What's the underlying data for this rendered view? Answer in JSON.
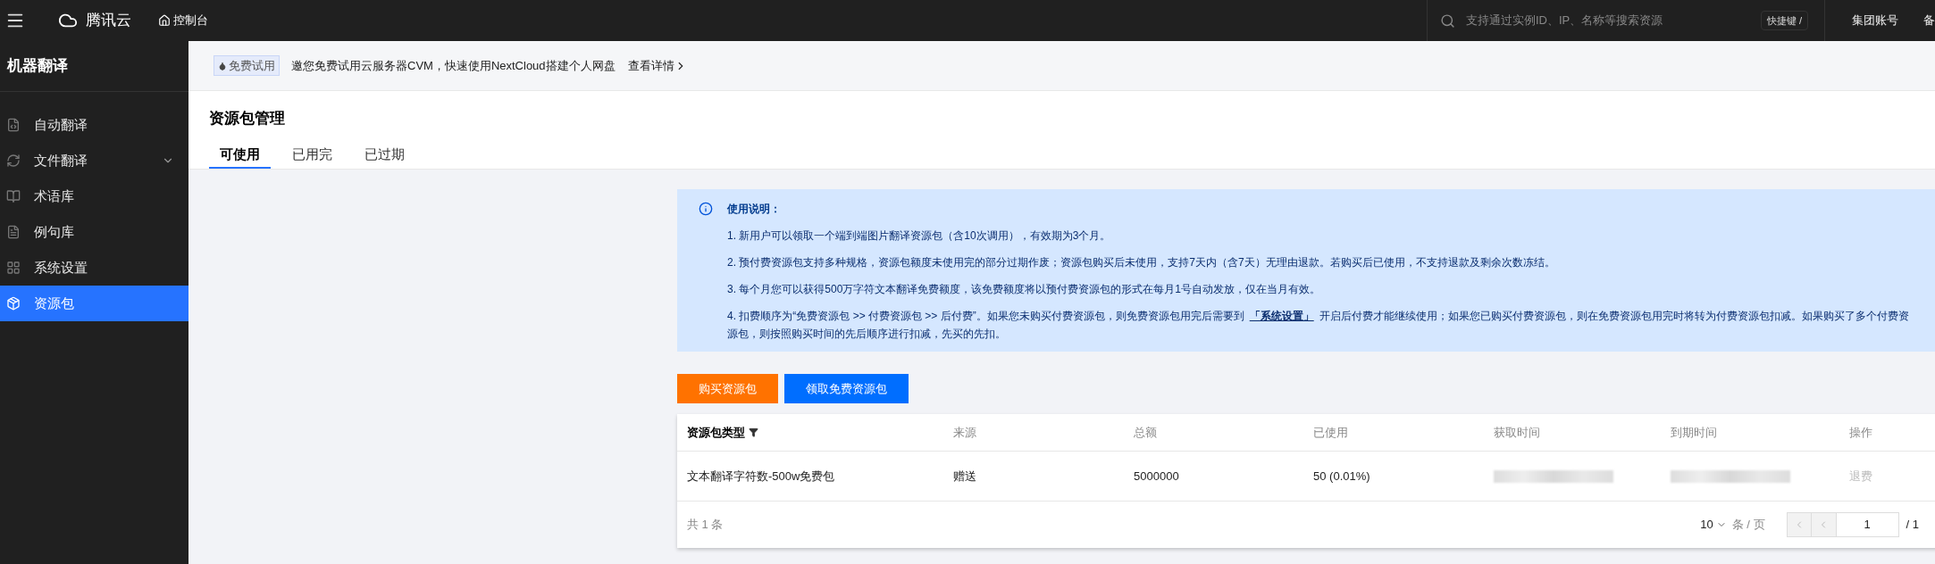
{
  "topbar": {
    "brand": "腾讯云",
    "console": "控制台",
    "search": {
      "placeholder": "支持通过实例ID、IP、名称等搜索资源"
    },
    "shortcut": "快捷键 /",
    "links": [
      "集团账号",
      "备"
    ]
  },
  "sidebar": {
    "title": "机器翻译",
    "items": [
      {
        "label": "自动翻译",
        "selected": false,
        "expandable": false
      },
      {
        "label": "文件翻译",
        "selected": false,
        "expandable": true
      },
      {
        "label": "术语库",
        "selected": false,
        "expandable": false
      },
      {
        "label": "例句库",
        "selected": false,
        "expandable": false
      },
      {
        "label": "系统设置",
        "selected": false,
        "expandable": false
      },
      {
        "label": "资源包",
        "selected": true,
        "expandable": false
      }
    ]
  },
  "banner": {
    "tag": "免费试用",
    "text": "邀您免费试用云服务器CVM，快速使用NextCloud搭建个人网盘",
    "link": "查看详情"
  },
  "page": {
    "title": "资源包管理",
    "tabs": [
      {
        "label": "可使用",
        "selected": true
      },
      {
        "label": "已用完",
        "selected": false
      },
      {
        "label": "已过期",
        "selected": false
      }
    ]
  },
  "notice": {
    "title": "使用说明：",
    "items": [
      {
        "text": "1. 新用户可以领取一个端到端图片翻译资源包（含10次调用），有效期为3个月。"
      },
      {
        "text": "2. 预付费资源包支持多种规格，资源包额度未使用完的部分过期作废；资源包购买后未使用，支持7天内（含7天）无理由退款。若购买后已使用，不支持退款及剩余次数冻结。"
      },
      {
        "text": "3. 每个月您可以获得500万字符文本翻译免费额度，该免费额度将以预付费资源包的形式在每月1号自动发放，仅在当月有效。"
      },
      {
        "text": "4. 扣费顺序为“免费资源包 >> 付费资源包 >> 后付费”。如果您未购买付费资源包，则免费资源包用完后需要到",
        "link": "「系统设置」",
        "after": "开启后付费才能继续使用；如果您已购买付费资源包，则在免费资源包用完时将转为付费资源包扣减。如果购买了多个付费资源包，则按照购买时间的先后顺序进行扣减，先买的先扣。"
      }
    ]
  },
  "buttons": [
    {
      "label": "购买资源包",
      "kind": "warning"
    },
    {
      "label": "领取免费资源包",
      "kind": "primary"
    }
  ],
  "table": {
    "columns": [
      {
        "label": "资源包类型",
        "filter": true
      },
      {
        "label": "来源",
        "filter": false
      },
      {
        "label": "总额",
        "filter": false
      },
      {
        "label": "已使用",
        "filter": false
      },
      {
        "label": "获取时间",
        "filter": false
      },
      {
        "label": "到期时间",
        "filter": false
      },
      {
        "label": "操作",
        "filter": false
      }
    ],
    "rows": [
      [
        {
          "kind": "text",
          "text": "文本翻译字符数-500w免费包"
        },
        {
          "kind": "text",
          "text": "赠送"
        },
        {
          "kind": "text",
          "text": "5000000"
        },
        {
          "kind": "text",
          "text": "50 (0.01%)"
        },
        {
          "kind": "blurred"
        },
        {
          "kind": "blurred"
        },
        {
          "kind": "action",
          "text": "退费",
          "disabled": true
        }
      ]
    ]
  },
  "pagination": {
    "total": "共 1 条",
    "page_size": "10",
    "per_page": "条 / 页",
    "page": "1",
    "pages": "/ 1"
  }
}
